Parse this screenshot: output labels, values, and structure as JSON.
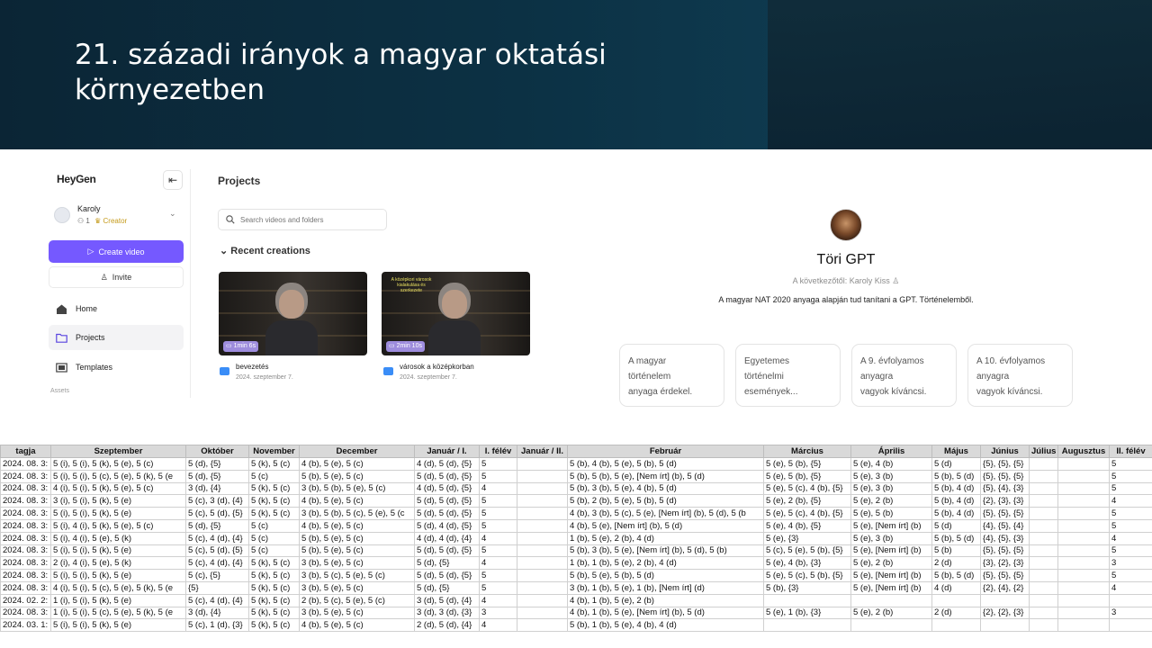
{
  "slide": {
    "title_line1": "21. századi irányok a magyar oktatási",
    "title_line2": "környezetben"
  },
  "heygen": {
    "logo": "HeyGen",
    "user": {
      "name": "Karoly",
      "count": "1",
      "badge": "Creator"
    },
    "create_label": "Create video",
    "invite_label": "Invite",
    "nav": [
      {
        "label": "Home",
        "icon": "home-icon"
      },
      {
        "label": "Projects",
        "icon": "folder-icon"
      },
      {
        "label": "Templates",
        "icon": "templates-icon"
      }
    ],
    "assets_label": "Assets",
    "projects_title": "Projects",
    "search_placeholder": "Search videos and folders",
    "recent_title": "Recent creations",
    "videos": [
      {
        "duration": "1min 6s",
        "name": "bevezetés",
        "date": "2024. szeptember 7."
      },
      {
        "duration": "2min 10s",
        "name": "városok a középkorban",
        "date": "2024. szeptember 7.",
        "overlay": "A középkori városok kialakulása és szerkezete"
      }
    ]
  },
  "gpt": {
    "name": "Töri GPT",
    "author": "A következőtől: Karoly Kiss",
    "description": "A magyar NAT 2020 anyaga alapján tud tanítani a GPT. Történelemből.",
    "starters": [
      [
        "A magyar",
        "történelem",
        "anyaga érdekel."
      ],
      [
        "Egyetemes",
        "történelmi",
        "események..."
      ],
      [
        "A 9. évfolyamos",
        "anyagra",
        "vagyok kíváncsi."
      ],
      [
        "A 10. évfolyamos",
        "anyagra",
        "vagyok kíváncsi."
      ]
    ]
  },
  "grades": {
    "headers": [
      "tagja",
      "Szeptember",
      "Október",
      "November",
      "December",
      "Január / I.",
      "I. félév",
      "Január / II.",
      "Február",
      "Március",
      "Április",
      "Május",
      "Június",
      "Július",
      "Augusztus",
      "II. félév"
    ],
    "rows": [
      [
        "2024. 08. 3:",
        "5 (i), 5 (i), 5 (k), 5 (e), 5 (c)",
        "5 (d), {5}",
        "5 (k), 5 (c)",
        "4 (b), 5 (e), 5 (c)",
        "4 (d), 5 (d), {5}",
        "5",
        "",
        "5 (b), 4 (b), 5 (e), 5 (b), 5 (d)",
        "5 (e), 5 (b), {5}",
        "5 (e), 4 (b)",
        "5 (d)",
        "{5}, {5}, {5}",
        "",
        "",
        "5"
      ],
      [
        "2024. 08. 3:",
        "5 (i), 5 (i), 5 (c), 5 (e), 5 (k), 5 (e",
        "5 (d), {5}",
        "5 (c)",
        "5 (b), 5 (e), 5 (c)",
        "5 (d), 5 (d), {5}",
        "5",
        "",
        "5 (b), 5 (b), 5 (e), [Nem írt] (b), 5 (d)",
        "5 (e), 5 (b), {5}",
        "5 (e), 3 (b)",
        "5 (b), 5 (d)",
        "{5}, {5}, {5}",
        "",
        "",
        "5"
      ],
      [
        "2024. 08. 3:",
        "4 (i), 5 (i), 5 (k), 5 (e), 5 (c)",
        "3 (d), {4}",
        "5 (k), 5 (c)",
        "3 (b), 5 (b), 5 (e), 5 (c)",
        "4 (d), 5 (d), {5}",
        "4",
        "",
        "5 (b), 3 (b), 5 (e), 4 (b), 5 (d)",
        "5 (e), 5 (c), 4 (b), {5}",
        "5 (e), 3 (b)",
        "5 (b), 4 (d)",
        "{5}, {4}, {3}",
        "",
        "",
        "5"
      ],
      [
        "2024. 08. 3:",
        "3 (i), 5 (i), 5 (k), 5 (e)",
        "5 (c), 3 (d), {4}",
        "5 (k), 5 (c)",
        "4 (b), 5 (e), 5 (c)",
        "5 (d), 5 (d), {5}",
        "5",
        "",
        "5 (b), 2 (b), 5 (e), 5 (b), 5 (d)",
        "5 (e), 2 (b), {5}",
        "5 (e), 2 (b)",
        "5 (b), 4 (d)",
        "{2}, {3}, {3}",
        "",
        "",
        "4"
      ],
      [
        "2024. 08. 3:",
        "5 (i), 5 (i), 5 (k), 5 (e)",
        "5 (c), 5 (d), {5}",
        "5 (k), 5 (c)",
        "3 (b), 5 (b), 5 (c), 5 (e), 5 (c",
        "5 (d), 5 (d), {5}",
        "5",
        "",
        "4 (b), 3 (b), 5 (c), 5 (e), [Nem írt] (b), 5 (d), 5 (b",
        "5 (e), 5 (c), 4 (b), {5}",
        "5 (e), 5 (b)",
        "5 (b), 4 (d)",
        "{5}, {5}, {5}",
        "",
        "",
        "5"
      ],
      [
        "2024. 08. 3:",
        "5 (i), 4 (i), 5 (k), 5 (e), 5 (c)",
        "5 (d), {5}",
        "5 (c)",
        "4 (b), 5 (e), 5 (c)",
        "5 (d), 4 (d), {5}",
        "5",
        "",
        "4 (b), 5 (e), [Nem írt] (b), 5 (d)",
        "5 (e), 4 (b), {5}",
        "5 (e), [Nem írt] (b)",
        "5 (d)",
        "{4}, {5}, {4}",
        "",
        "",
        "5"
      ],
      [
        "2024. 08. 3:",
        "5 (i), 4 (i), 5 (e), 5 (k)",
        "5 (c), 4 (d), {4}",
        "5 (c)",
        "5 (b), 5 (e), 5 (c)",
        "4 (d), 4 (d), {4}",
        "4",
        "",
        "1 (b), 5 (e), 2 (b), 4 (d)",
        "5 (e), {3}",
        "5 (e), 3 (b)",
        "5 (b), 5 (d)",
        "{4}, {5}, {3}",
        "",
        "",
        "4"
      ],
      [
        "2024. 08. 3:",
        "5 (i), 5 (i), 5 (k), 5 (e)",
        "5 (c), 5 (d), {5}",
        "5 (c)",
        "5 (b), 5 (e), 5 (c)",
        "5 (d), 5 (d), {5}",
        "5",
        "",
        "5 (b), 3 (b), 5 (e), [Nem írt] (b), 5 (d), 5 (b)",
        "5 (c), 5 (e), 5 (b), {5}",
        "5 (e), [Nem írt] (b)",
        "5 (b)",
        "{5}, {5}, {5}",
        "",
        "",
        "5"
      ],
      [
        "2024. 08. 3:",
        "2 (i), 4 (i), 5 (e), 5 (k)",
        "5 (c), 4 (d), {4}",
        "5 (k), 5 (c)",
        "3 (b), 5 (e), 5 (c)",
        "5 (d), {5}",
        "4",
        "",
        "1 (b), 1 (b), 5 (e), 2 (b), 4 (d)",
        "5 (e), 4 (b), {3}",
        "5 (e), 2 (b)",
        "2 (d)",
        "{3}, {2}, {3}",
        "",
        "",
        "3"
      ],
      [
        "2024. 08. 3:",
        "5 (i), 5 (i), 5 (k), 5 (e)",
        "5 (c), {5}",
        "5 (k), 5 (c)",
        "3 (b), 5 (c), 5 (e), 5 (c)",
        "5 (d), 5 (d), {5}",
        "5",
        "",
        "5 (b), 5 (e), 5 (b), 5 (d)",
        "5 (e), 5 (c), 5 (b), {5}",
        "5 (e), [Nem írt] (b)",
        "5 (b), 5 (d)",
        "{5}, {5}, {5}",
        "",
        "",
        "5"
      ],
      [
        "2024. 08. 3:",
        "4 (i), 5 (i), 5 (c), 5 (e), 5 (k), 5 (e",
        "{5}",
        "5 (k), 5 (c)",
        "3 (b), 5 (e), 5 (c)",
        "5 (d), {5}",
        "5",
        "",
        "3 (b), 1 (b), 5 (e), 1 (b), [Nem írt] (d)",
        "5 (b), {3}",
        "5 (e), [Nem írt] (b)",
        "4 (d)",
        "{2}, {4}, {2}",
        "",
        "",
        "4"
      ],
      [
        "2024. 02. 2:",
        "1 (i), 5 (i), 5 (k), 5 (e)",
        "5 (c), 4 (d), {4}",
        "5 (k), 5 (c)",
        "2 (b), 5 (c), 5 (e), 5 (c)",
        "3 (d), 5 (d), {4}",
        "4",
        "",
        "4 (b), 1 (b), 5 (e), 2 (b)",
        "",
        "",
        "",
        "",
        "",
        "",
        ""
      ],
      [
        "2024. 08. 3:",
        "1 (i), 5 (i), 5 (c), 5 (e), 5 (k), 5 (e",
        "3 (d), {4}",
        "5 (k), 5 (c)",
        "3 (b), 5 (e), 5 (c)",
        "3 (d), 3 (d), {3}",
        "3",
        "",
        "4 (b), 1 (b), 5 (e), [Nem írt] (b), 5 (d)",
        "5 (e), 1 (b), {3}",
        "5 (e), 2 (b)",
        "2 (d)",
        "{2}, {2}, {3}",
        "",
        "",
        "3"
      ],
      [
        "2024. 03. 1:",
        "5 (i), 5 (i), 5 (k), 5 (e)",
        "5 (c), 1 (d), {3}",
        "5 (k), 5 (c)",
        "4 (b), 5 (e), 5 (c)",
        "2 (d), 5 (d), {4}",
        "4",
        "",
        "5 (b), 1 (b), 5 (e), 4 (b), 4 (d)",
        "",
        "",
        "",
        "",
        "",
        "",
        ""
      ]
    ]
  }
}
